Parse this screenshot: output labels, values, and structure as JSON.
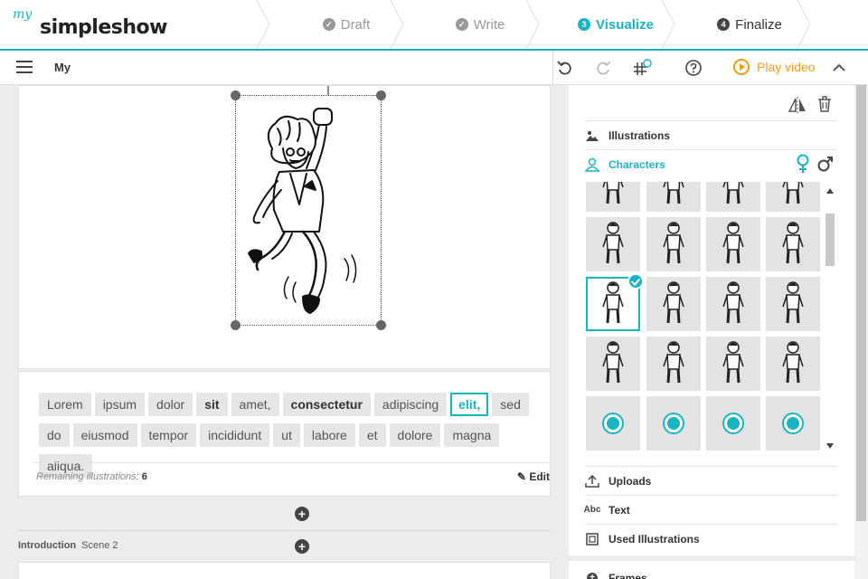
{
  "logo": {
    "prefix": "my",
    "name": "simpleshow"
  },
  "steps": [
    {
      "label": "Draft",
      "badge": "✓",
      "state": "done"
    },
    {
      "label": "Write",
      "badge": "✓",
      "state": "done"
    },
    {
      "label": "Visualize",
      "badge": "3",
      "state": "active"
    },
    {
      "label": "Finalize",
      "badge": "4",
      "state": "upcoming"
    }
  ],
  "toolbar": {
    "project_title": "My",
    "play_label": "Play video",
    "icons": [
      "undo-icon",
      "redo-icon",
      "grid-icon",
      "help-icon",
      "collapse-icon"
    ]
  },
  "editor": {
    "words": [
      {
        "text": "Lorem",
        "style": "normal"
      },
      {
        "text": "ipsum",
        "style": "normal"
      },
      {
        "text": "dolor",
        "style": "normal"
      },
      {
        "text": "sit",
        "style": "bold"
      },
      {
        "text": "amet,",
        "style": "normal"
      },
      {
        "text": "consectetur",
        "style": "bold"
      },
      {
        "text": "adipiscing",
        "style": "normal"
      },
      {
        "text": "elit,",
        "style": "selected"
      },
      {
        "text": "sed",
        "style": "normal"
      },
      {
        "text": "do",
        "style": "normal"
      },
      {
        "text": "eiusmod",
        "style": "normal"
      },
      {
        "text": "tempor",
        "style": "normal"
      },
      {
        "text": "incididunt",
        "style": "normal"
      },
      {
        "text": "ut",
        "style": "normal"
      },
      {
        "text": "labore",
        "style": "normal"
      },
      {
        "text": "et",
        "style": "normal"
      },
      {
        "text": "dolore",
        "style": "normal"
      },
      {
        "text": "magna",
        "style": "normal"
      },
      {
        "text": "aliqua.",
        "style": "normal"
      }
    ],
    "remaining_label": "Remaining illustrations:",
    "remaining_count": "6",
    "edit_label": "Edit"
  },
  "scene": {
    "section": "Introduction",
    "name": "Scene 2"
  },
  "panel": {
    "illustrations_label": "Illustrations",
    "characters_label": "Characters",
    "uploads_label": "Uploads",
    "text_label": "Text",
    "text_icon": "Abc",
    "used_label": "Used Illustrations",
    "frames_label": "Frames",
    "accent_color": "#19b4c4",
    "selected_thumb_index": 8
  }
}
